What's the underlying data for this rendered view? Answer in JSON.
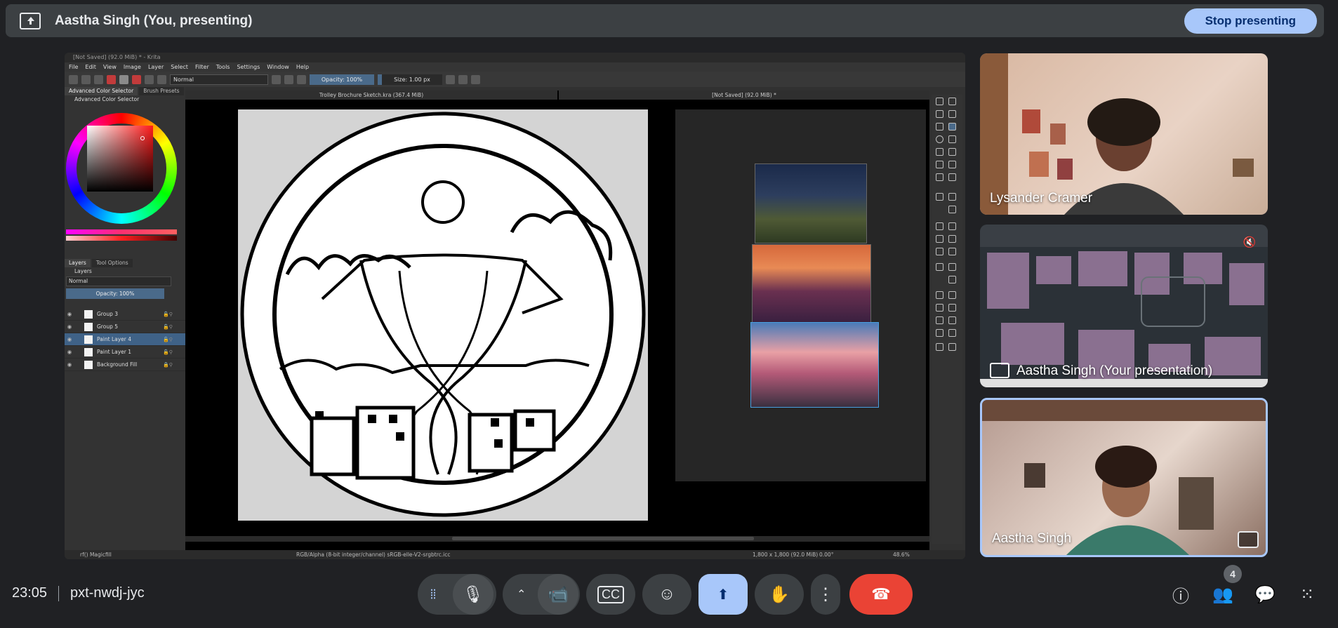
{
  "banner": {
    "title": "Aastha Singh (You, presenting)",
    "stop_label": "Stop presenting"
  },
  "krita": {
    "window_title": "[Not Saved] (92.0 MiB) * - Krita",
    "menu": [
      "File",
      "Edit",
      "View",
      "Image",
      "Layer",
      "Select",
      "Filter",
      "Tools",
      "Settings",
      "Window",
      "Help"
    ],
    "blend_mode": "Normal",
    "opacity": "Opacity: 100%",
    "size": "Size: 1.00 px",
    "docker_tabs": [
      "Advanced Color Selector",
      "Brush Presets"
    ],
    "docker_title": "Advanced Color Selector",
    "layer_tabs": [
      "Layers",
      "Tool Options"
    ],
    "layers_title": "Layers",
    "layers_blend": "Normal",
    "layers_opacity": "Opacity: 100%",
    "layers": [
      {
        "name": "Group 3",
        "selected": false
      },
      {
        "name": "Group 5",
        "selected": false
      },
      {
        "name": "Paint Layer 4",
        "selected": true
      },
      {
        "name": "Paint Layer 1",
        "selected": false
      },
      {
        "name": "Background Fill",
        "selected": false
      }
    ],
    "doc_tab_1": "Trolley Brochure Sketch.kra (367.4 MiB)",
    "doc_tab_2": "[Not Saved]  (92.0 MiB) *",
    "status_left": "rf() Magicfill",
    "status_mid": "RGB/Alpha (8-bit integer/channel)  sRGB-elle-V2-srgbtrc.icc",
    "status_dims": "1,800 x 1,800 (92.0 MiB)",
    "status_rot": "0.00°",
    "status_zoom": "48.6%"
  },
  "participants": [
    {
      "name": "Lysander Cramer"
    },
    {
      "name": "Aastha Singh (Your presentation)"
    },
    {
      "name": "Aastha Singh"
    }
  ],
  "bottom": {
    "time": "23:05",
    "meeting_code": "pxt-nwdj-jyc",
    "participant_count": "4"
  },
  "colors": {
    "accent": "#a8c7fa",
    "leave": "#ea4335",
    "surface": "#3c4043",
    "background": "#202124"
  }
}
